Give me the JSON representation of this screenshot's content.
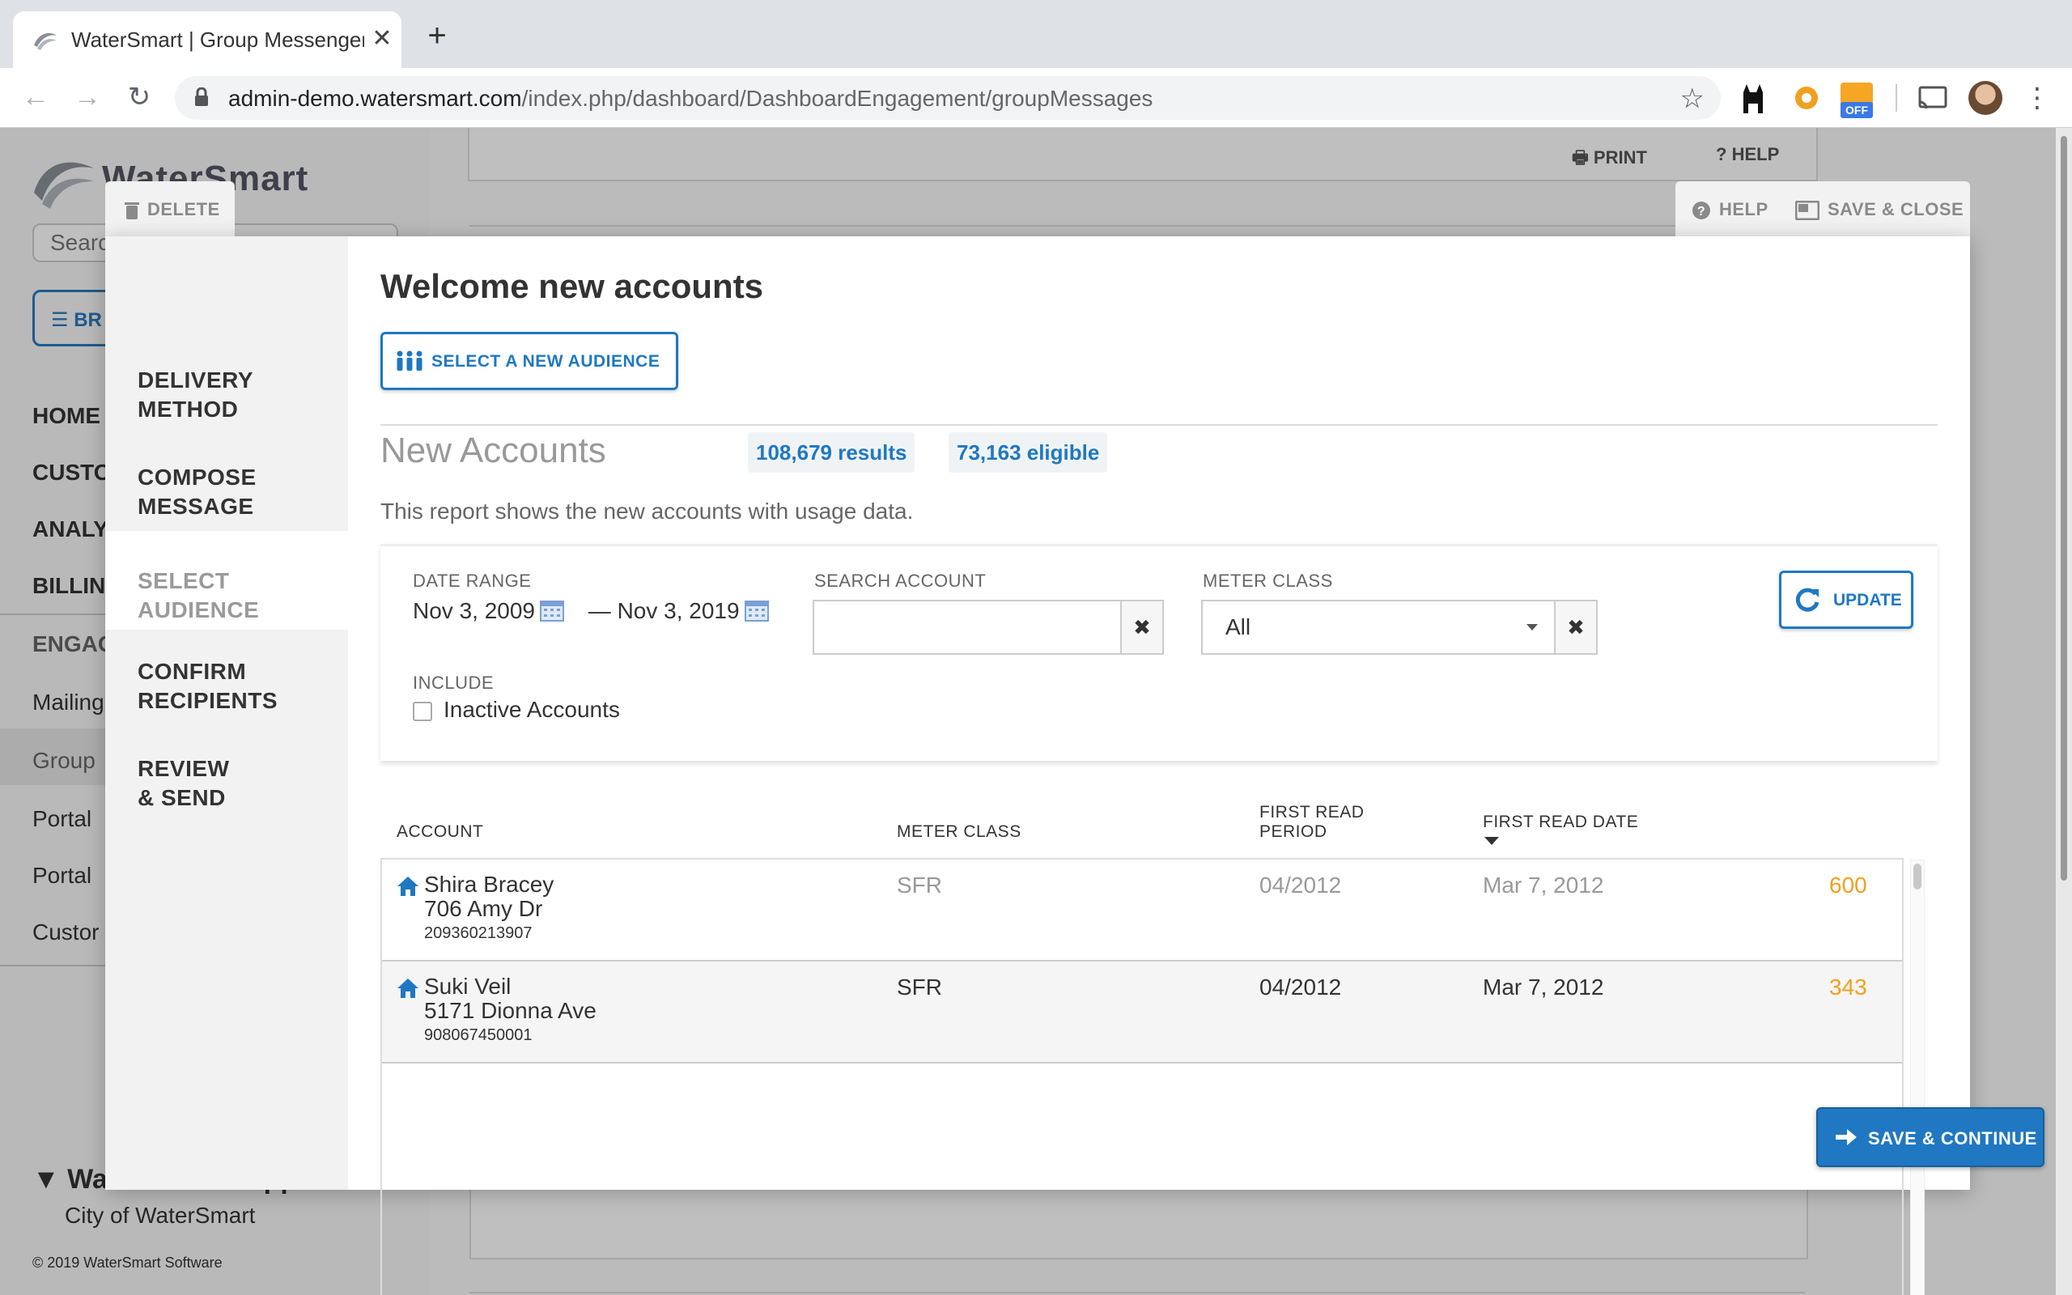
{
  "browser": {
    "tab_title": "WaterSmart | Group Messenger",
    "tab_close": "✕",
    "new_tab": "+",
    "url_host": "admin-demo.watersmart.com",
    "url_path": "/index.php/dashboard/DashboardEngagement/groupMessages",
    "ext_badge": "OFF"
  },
  "background": {
    "logo": "WaterSmart",
    "search_placeholder": "Search",
    "browse_label": "BR",
    "nav": [
      "HOME",
      "CUSTO",
      "ANALY",
      "BILLIN",
      "ENGAG"
    ],
    "sub_nav": [
      "Mailing",
      "Group",
      "Portal",
      "Portal",
      "Custor"
    ],
    "support_user": "WaterSmart Support",
    "city": "City of WaterSmart",
    "copyright": "© 2019 WaterSmart Software",
    "print_label": "PRINT",
    "help_label": "HELP"
  },
  "modal": {
    "delete_label": "DELETE",
    "help_label": "HELP",
    "save_close_label": "SAVE & CLOSE",
    "title": "Welcome new accounts",
    "select_audience_button": "SELECT A NEW AUDIENCE",
    "steps": [
      {
        "line1": "DELIVERY",
        "line2": "METHOD"
      },
      {
        "line1": "COMPOSE",
        "line2": "MESSAGE"
      },
      {
        "line1": "SELECT",
        "line2": "AUDIENCE"
      },
      {
        "line1": "CONFIRM",
        "line2": "RECIPIENTS"
      },
      {
        "line1": "REVIEW",
        "line2": "& SEND"
      }
    ],
    "active_step": 2,
    "report": {
      "title": "New Accounts",
      "results": "108,679 results",
      "eligible": "73,163 eligible",
      "description": "This report shows the new accounts with usage data."
    },
    "filters": {
      "date_range_label": "DATE RANGE",
      "date_from": "Nov 3, 2009",
      "date_sep": "—",
      "date_to": "Nov 3, 2019",
      "search_label": "SEARCH ACCOUNT",
      "search_value": "",
      "meter_label": "METER CLASS",
      "meter_value": "All",
      "include_label": "INCLUDE",
      "inactive_label": "Inactive Accounts",
      "inactive_checked": false,
      "update_button": "UPDATE",
      "clear_glyph": "✖"
    },
    "table": {
      "columns": {
        "account": "ACCOUNT",
        "meter_class": "METER CLASS",
        "first_read_period_1": "FIRST READ",
        "first_read_period_2": "PERIOD",
        "first_read_date": "FIRST READ DATE"
      },
      "rows": [
        {
          "name": "Shira Bracey",
          "address": "706 Amy Dr",
          "account": "209360213907",
          "meter_class": "SFR",
          "period": "04/2012",
          "date": "Mar 7, 2012",
          "usage": "600"
        },
        {
          "name": "Suki Veil",
          "address": "5171 Dionna Ave",
          "account": "908067450001",
          "meter_class": "SFR",
          "period": "04/2012",
          "date": "Mar 7, 2012",
          "usage": "343"
        }
      ]
    },
    "save_continue_button": "SAVE & CONTINUE"
  },
  "colors": {
    "accent": "#1f78c1",
    "usage": "#f0a020"
  }
}
